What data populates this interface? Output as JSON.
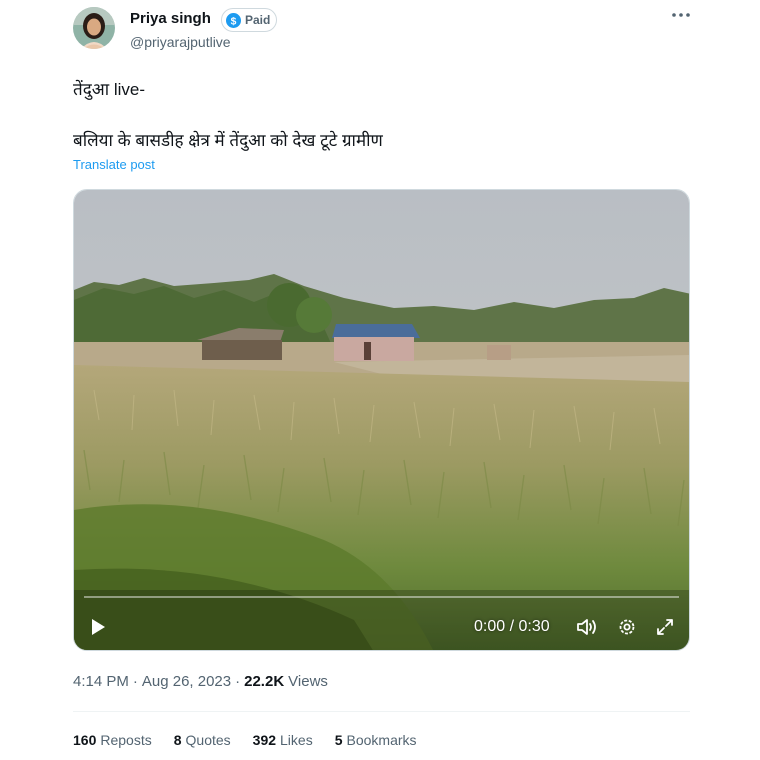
{
  "author": {
    "name": "Priya singh",
    "badge_label": "Paid",
    "handle": "@priyarajputlive"
  },
  "post": {
    "line1": "तेंदुआ live-",
    "line2": "बलिया के बासडीह क्षेत्र में तेंदुआ को देख टूटे ग्रामीण",
    "translate_label": "Translate post"
  },
  "video": {
    "time_display": "0:00 / 0:30",
    "progress": 0
  },
  "meta": {
    "time": "4:14 PM",
    "separator": "·",
    "date": "Aug 26, 2023",
    "views_count": "22.2K",
    "views_label": "Views"
  },
  "stats": [
    {
      "count": "160",
      "label": "Reposts"
    },
    {
      "count": "8",
      "label": "Quotes"
    },
    {
      "count": "392",
      "label": "Likes"
    },
    {
      "count": "5",
      "label": "Bookmarks"
    }
  ],
  "colors": {
    "accent": "#1d9bf0",
    "text": "#0f1419",
    "muted": "#536471"
  },
  "icons": {
    "more": "more-horizontal-icon",
    "badge": "dollar-badge-icon",
    "play": "play-icon",
    "volume": "volume-icon",
    "settings": "gear-icon",
    "fullscreen": "expand-icon"
  }
}
